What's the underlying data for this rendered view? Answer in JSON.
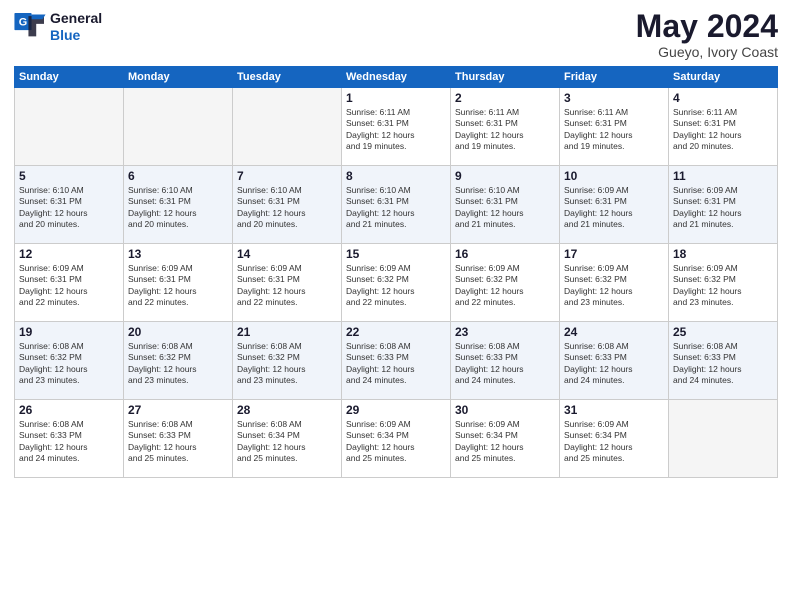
{
  "logo": {
    "line1": "General",
    "line2": "Blue"
  },
  "title": "May 2024",
  "location": "Gueyo, Ivory Coast",
  "weekdays": [
    "Sunday",
    "Monday",
    "Tuesday",
    "Wednesday",
    "Thursday",
    "Friday",
    "Saturday"
  ],
  "weeks": [
    {
      "alt": false,
      "days": [
        {
          "num": "",
          "info": ""
        },
        {
          "num": "",
          "info": ""
        },
        {
          "num": "",
          "info": ""
        },
        {
          "num": "1",
          "info": "Sunrise: 6:11 AM\nSunset: 6:31 PM\nDaylight: 12 hours\nand 19 minutes."
        },
        {
          "num": "2",
          "info": "Sunrise: 6:11 AM\nSunset: 6:31 PM\nDaylight: 12 hours\nand 19 minutes."
        },
        {
          "num": "3",
          "info": "Sunrise: 6:11 AM\nSunset: 6:31 PM\nDaylight: 12 hours\nand 19 minutes."
        },
        {
          "num": "4",
          "info": "Sunrise: 6:11 AM\nSunset: 6:31 PM\nDaylight: 12 hours\nand 20 minutes."
        }
      ]
    },
    {
      "alt": true,
      "days": [
        {
          "num": "5",
          "info": "Sunrise: 6:10 AM\nSunset: 6:31 PM\nDaylight: 12 hours\nand 20 minutes."
        },
        {
          "num": "6",
          "info": "Sunrise: 6:10 AM\nSunset: 6:31 PM\nDaylight: 12 hours\nand 20 minutes."
        },
        {
          "num": "7",
          "info": "Sunrise: 6:10 AM\nSunset: 6:31 PM\nDaylight: 12 hours\nand 20 minutes."
        },
        {
          "num": "8",
          "info": "Sunrise: 6:10 AM\nSunset: 6:31 PM\nDaylight: 12 hours\nand 21 minutes."
        },
        {
          "num": "9",
          "info": "Sunrise: 6:10 AM\nSunset: 6:31 PM\nDaylight: 12 hours\nand 21 minutes."
        },
        {
          "num": "10",
          "info": "Sunrise: 6:09 AM\nSunset: 6:31 PM\nDaylight: 12 hours\nand 21 minutes."
        },
        {
          "num": "11",
          "info": "Sunrise: 6:09 AM\nSunset: 6:31 PM\nDaylight: 12 hours\nand 21 minutes."
        }
      ]
    },
    {
      "alt": false,
      "days": [
        {
          "num": "12",
          "info": "Sunrise: 6:09 AM\nSunset: 6:31 PM\nDaylight: 12 hours\nand 22 minutes."
        },
        {
          "num": "13",
          "info": "Sunrise: 6:09 AM\nSunset: 6:31 PM\nDaylight: 12 hours\nand 22 minutes."
        },
        {
          "num": "14",
          "info": "Sunrise: 6:09 AM\nSunset: 6:31 PM\nDaylight: 12 hours\nand 22 minutes."
        },
        {
          "num": "15",
          "info": "Sunrise: 6:09 AM\nSunset: 6:32 PM\nDaylight: 12 hours\nand 22 minutes."
        },
        {
          "num": "16",
          "info": "Sunrise: 6:09 AM\nSunset: 6:32 PM\nDaylight: 12 hours\nand 22 minutes."
        },
        {
          "num": "17",
          "info": "Sunrise: 6:09 AM\nSunset: 6:32 PM\nDaylight: 12 hours\nand 23 minutes."
        },
        {
          "num": "18",
          "info": "Sunrise: 6:09 AM\nSunset: 6:32 PM\nDaylight: 12 hours\nand 23 minutes."
        }
      ]
    },
    {
      "alt": true,
      "days": [
        {
          "num": "19",
          "info": "Sunrise: 6:08 AM\nSunset: 6:32 PM\nDaylight: 12 hours\nand 23 minutes."
        },
        {
          "num": "20",
          "info": "Sunrise: 6:08 AM\nSunset: 6:32 PM\nDaylight: 12 hours\nand 23 minutes."
        },
        {
          "num": "21",
          "info": "Sunrise: 6:08 AM\nSunset: 6:32 PM\nDaylight: 12 hours\nand 23 minutes."
        },
        {
          "num": "22",
          "info": "Sunrise: 6:08 AM\nSunset: 6:33 PM\nDaylight: 12 hours\nand 24 minutes."
        },
        {
          "num": "23",
          "info": "Sunrise: 6:08 AM\nSunset: 6:33 PM\nDaylight: 12 hours\nand 24 minutes."
        },
        {
          "num": "24",
          "info": "Sunrise: 6:08 AM\nSunset: 6:33 PM\nDaylight: 12 hours\nand 24 minutes."
        },
        {
          "num": "25",
          "info": "Sunrise: 6:08 AM\nSunset: 6:33 PM\nDaylight: 12 hours\nand 24 minutes."
        }
      ]
    },
    {
      "alt": false,
      "days": [
        {
          "num": "26",
          "info": "Sunrise: 6:08 AM\nSunset: 6:33 PM\nDaylight: 12 hours\nand 24 minutes."
        },
        {
          "num": "27",
          "info": "Sunrise: 6:08 AM\nSunset: 6:33 PM\nDaylight: 12 hours\nand 25 minutes."
        },
        {
          "num": "28",
          "info": "Sunrise: 6:08 AM\nSunset: 6:34 PM\nDaylight: 12 hours\nand 25 minutes."
        },
        {
          "num": "29",
          "info": "Sunrise: 6:09 AM\nSunset: 6:34 PM\nDaylight: 12 hours\nand 25 minutes."
        },
        {
          "num": "30",
          "info": "Sunrise: 6:09 AM\nSunset: 6:34 PM\nDaylight: 12 hours\nand 25 minutes."
        },
        {
          "num": "31",
          "info": "Sunrise: 6:09 AM\nSunset: 6:34 PM\nDaylight: 12 hours\nand 25 minutes."
        },
        {
          "num": "",
          "info": ""
        }
      ]
    }
  ]
}
